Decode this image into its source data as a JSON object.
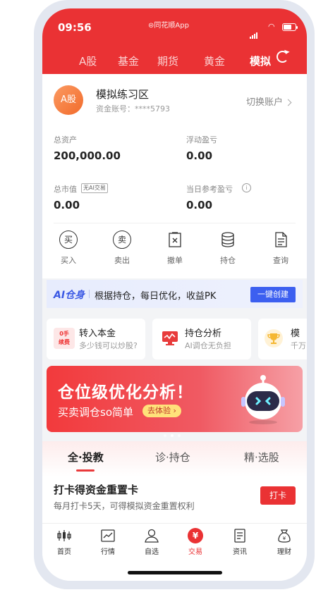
{
  "status_bar": {
    "time": "09:56",
    "app_name": "⊜同花顺App"
  },
  "header": {
    "tabs": [
      {
        "label": "A股",
        "active": false
      },
      {
        "label": "基金",
        "active": false
      },
      {
        "label": "期货",
        "active": false
      },
      {
        "label": "黄金",
        "active": false
      },
      {
        "label": "模拟",
        "active": true
      }
    ],
    "refresh_icon": "refresh-icon",
    "color": "#ea3234"
  },
  "account": {
    "avatar_text": "A股",
    "name": "模拟练习区",
    "number": "资金账号：****5793",
    "switch_label": "切换账户"
  },
  "stats": {
    "total_assets_label": "总资产",
    "total_assets": "200,000.00",
    "floating_pl_label": "浮动盈亏",
    "floating_pl": "0.00",
    "market_value_label": "总市值",
    "ai_tag": "无AI交易",
    "market_value": "0.00",
    "daily_pl_label": "当日参考盈亏",
    "daily_pl": "0.00"
  },
  "operations": [
    {
      "label": "买入",
      "glyph": "买",
      "icon": "buy-icon"
    },
    {
      "label": "卖出",
      "glyph": "卖",
      "icon": "sell-icon"
    },
    {
      "label": "撤单",
      "icon": "cancel-order-icon"
    },
    {
      "label": "持仓",
      "icon": "holdings-icon"
    },
    {
      "label": "查询",
      "icon": "query-icon"
    }
  ],
  "ai_bar": {
    "logo": "AI仓身",
    "text": "根据持仓，每日优化，收益PK",
    "button": "一键创建",
    "accent": "#3c5ff0"
  },
  "cards": [
    {
      "badge_top": "0手",
      "badge_bottom": "续费",
      "title": "转入本金",
      "subtitle": "多少钱可以炒股?"
    },
    {
      "title": "持仓分析",
      "subtitle": "AI调仓无负担"
    },
    {
      "title": "模",
      "subtitle": "千万"
    }
  ],
  "banner": {
    "title": "仓位级优化分析！",
    "subtitle": "买卖调仓so简单",
    "button": "去体验 ›"
  },
  "segments": [
    {
      "label": "全·投教",
      "active": true
    },
    {
      "label": "诊·持仓",
      "active": false
    },
    {
      "label": "精·选股",
      "active": false
    }
  ],
  "task": {
    "title": "打卡得资金重置卡",
    "subtitle": "每月打卡5天，可得模拟资金重置权利",
    "button": "打卡"
  },
  "bottom_nav": [
    {
      "label": "首页",
      "icon": "home-icon",
      "active": false
    },
    {
      "label": "行情",
      "icon": "market-icon",
      "active": false
    },
    {
      "label": "自选",
      "icon": "watchlist-icon",
      "active": false
    },
    {
      "label": "交易",
      "icon": "trade-icon",
      "glyph": "¥",
      "active": true
    },
    {
      "label": "资讯",
      "icon": "news-icon",
      "active": false
    },
    {
      "label": "理财",
      "icon": "wealth-icon",
      "active": false
    }
  ]
}
